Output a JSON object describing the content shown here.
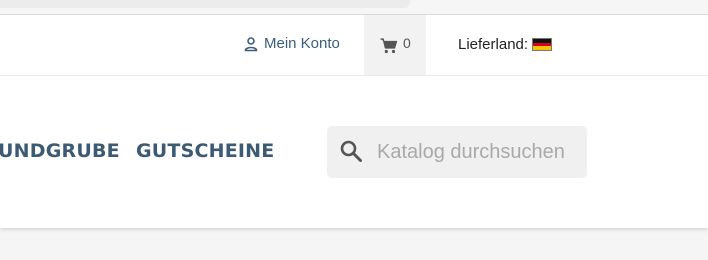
{
  "user_bar": {
    "account_label": "Mein Konto",
    "cart_count": "0",
    "delivery_label": "Lieferland:",
    "delivery_country_icon": "germany-flag-icon"
  },
  "nav": {
    "items": [
      {
        "label": "UNDGRUBE"
      },
      {
        "label": "GUTSCHEINE"
      }
    ]
  },
  "search": {
    "placeholder": "Katalog durchsuchen",
    "value": ""
  },
  "colors": {
    "nav_text": "#3c5a73",
    "link_text": "#3b5f7b",
    "header_bg": "#ffffff",
    "page_bg": "#f5f5f5",
    "search_bg": "#f0f0f0"
  }
}
